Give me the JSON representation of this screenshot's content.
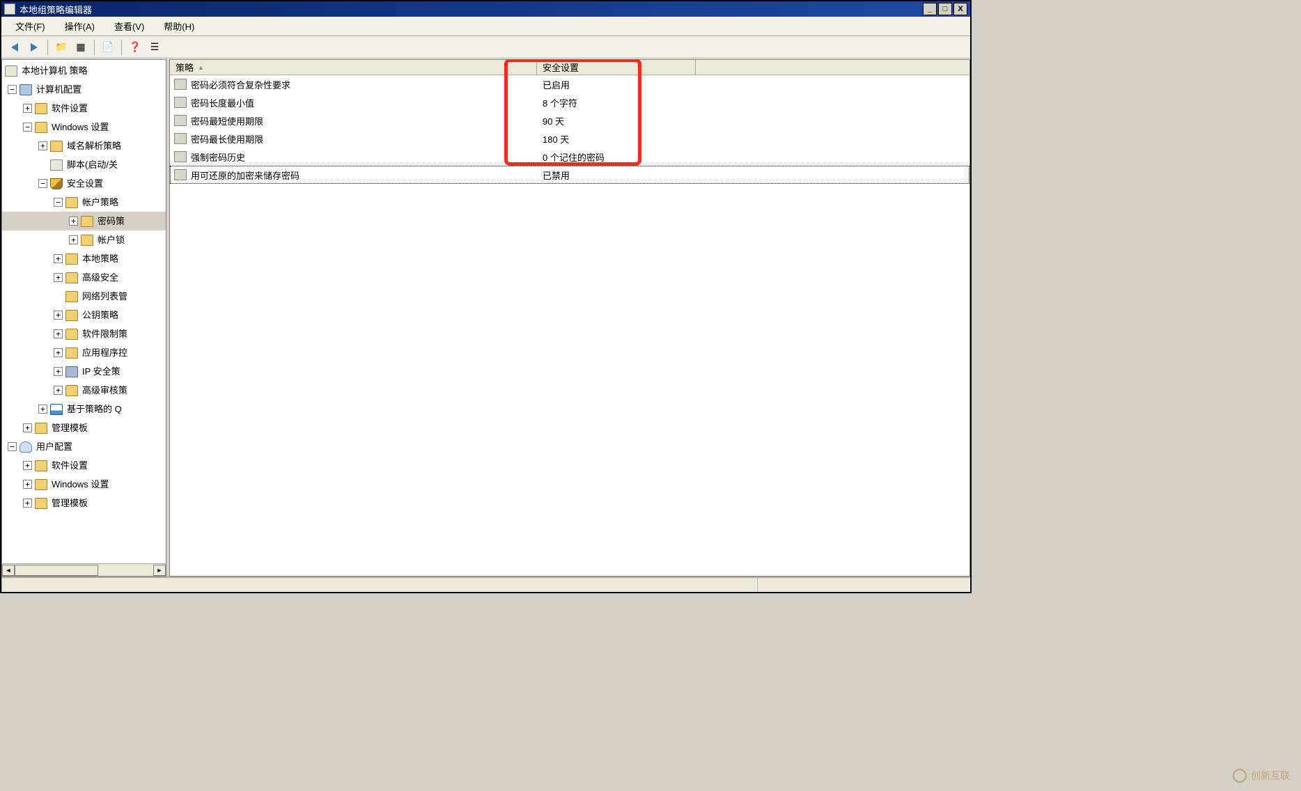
{
  "window": {
    "title": "本地组策略编辑器",
    "controls": {
      "min": "_",
      "max": "□",
      "close": "X"
    }
  },
  "menu": {
    "file": "文件(F)",
    "action": "操作(A)",
    "view": "查看(V)",
    "help": "帮助(H)"
  },
  "tree": {
    "root": "本地计算机 策略",
    "computer_config": "计算机配置",
    "software_settings": "软件设置",
    "windows_settings": "Windows 设置",
    "dns_policy": "域名解析策略",
    "scripts": "脚本(启动/关",
    "security_settings": "安全设置",
    "account_policies": "帐户策略",
    "password_policy": "密码策",
    "account_lockout": "帐户锁",
    "local_policies": "本地策略",
    "advanced_security": "高级安全",
    "network_list": "网络列表管",
    "public_key": "公钥策略",
    "software_restrict": "软件限制策",
    "app_control": "应用程序控",
    "ip_security": "IP 安全策",
    "advanced_audit": "高级审核策",
    "policy_based_qos": "基于策略的 Q",
    "admin_templates": "管理模板",
    "user_config": "用户配置",
    "user_software": "软件设置",
    "user_windows": "Windows 设置",
    "user_admin_templates": "管理模板"
  },
  "list": {
    "header_policy": "策略",
    "header_setting": "安全设置",
    "rows": [
      {
        "name": "密码必须符合复杂性要求",
        "value": "已启用"
      },
      {
        "name": "密码长度最小值",
        "value": "8 个字符"
      },
      {
        "name": "密码最短使用期限",
        "value": "90 天"
      },
      {
        "name": "密码最长使用期限",
        "value": "180 天"
      },
      {
        "name": "强制密码历史",
        "value": "0 个记住的密码"
      },
      {
        "name": "用可还原的加密来储存密码",
        "value": "已禁用"
      }
    ]
  },
  "watermark": "创新互联"
}
